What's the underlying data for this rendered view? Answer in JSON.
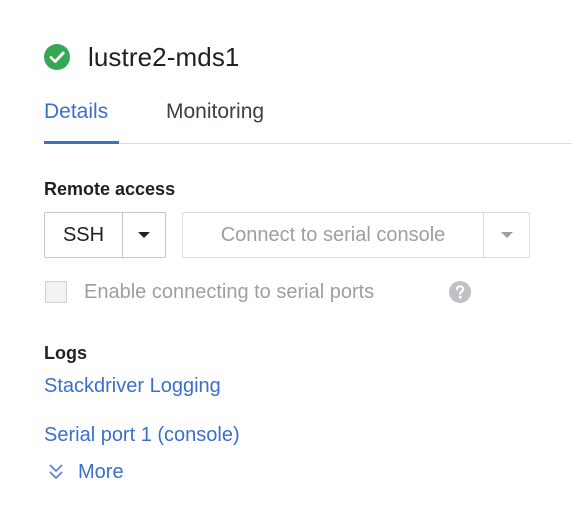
{
  "instance": {
    "name": "lustre2-mds1",
    "status_icon": "check-circle-icon",
    "status_color": "#34a853"
  },
  "tabs": [
    {
      "label": "Details",
      "active": true
    },
    {
      "label": "Monitoring",
      "active": false
    }
  ],
  "remote_access": {
    "heading": "Remote access",
    "ssh_label": "SSH",
    "serial_console_label": "Connect to serial console",
    "serial_ports_checkbox_label": "Enable connecting to serial ports",
    "serial_ports_checked": false
  },
  "logs": {
    "heading": "Logs",
    "links": [
      "Stackdriver Logging",
      "Serial port 1 (console)"
    ],
    "more_label": "More"
  },
  "colors": {
    "accent": "#3b6fce",
    "disabled_text": "#9aa0a6",
    "divider": "#dadce0"
  }
}
